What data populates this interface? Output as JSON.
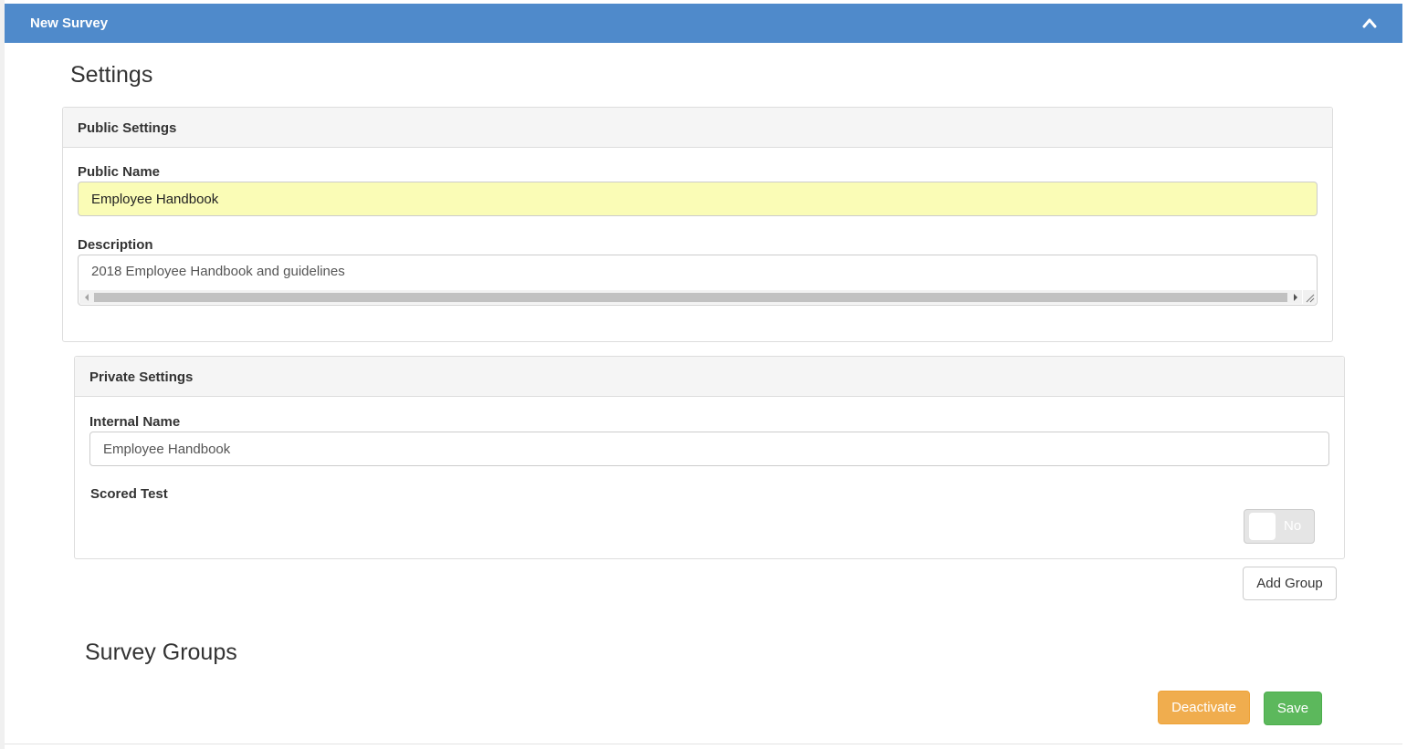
{
  "header": {
    "title": "New Survey",
    "collapse_icon": "chevron-up-icon",
    "color": "#4f8acb"
  },
  "page_title": "Settings",
  "public_settings": {
    "heading": "Public Settings",
    "public_name_label": "Public Name",
    "public_name_value": "Employee Handbook",
    "description_label": "Description",
    "description_value": "2018 Employee Handbook and guidelines"
  },
  "private_settings": {
    "heading": "Private Settings",
    "internal_name_label": "Internal Name",
    "internal_name_value": "Employee Handbook",
    "scored_test_label": "Scored Test",
    "scored_test_toggle_text": "No",
    "scored_test_on": false
  },
  "buttons": {
    "add_group": "Add Group",
    "deactivate": "Deactivate",
    "save": "Save"
  },
  "survey_groups_title": "Survey Groups",
  "colors": {
    "warning": "#f0ad4e",
    "success": "#5cb85c",
    "autofill": "#fafcb6"
  }
}
